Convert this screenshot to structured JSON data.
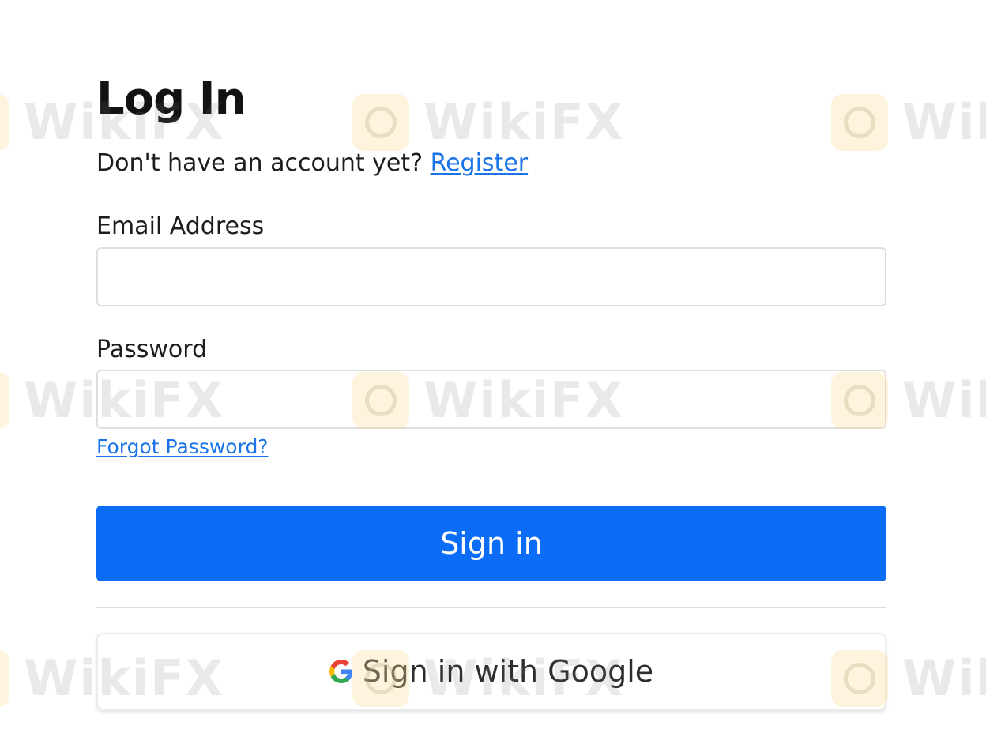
{
  "login": {
    "title": "Log In",
    "no_account_text": "Don't have an account yet?",
    "register_link": "Register",
    "email_label": "Email Address",
    "email_value": "",
    "password_label": "Password",
    "password_value": "",
    "forgot_link": "Forgot Password?",
    "sign_in_label": "Sign in",
    "google_label": "Sign in with Google"
  },
  "watermark": {
    "text": "WikiFX"
  },
  "colors": {
    "primary_button": "#0b6cf8",
    "link": "#1a73e8",
    "google_blue": "#4285F4",
    "google_green": "#34A853",
    "google_yellow": "#FBBC05",
    "google_red": "#EA4335"
  },
  "icons": {
    "google": "google-g-icon",
    "watermark": "wikifx-logo-icon"
  }
}
